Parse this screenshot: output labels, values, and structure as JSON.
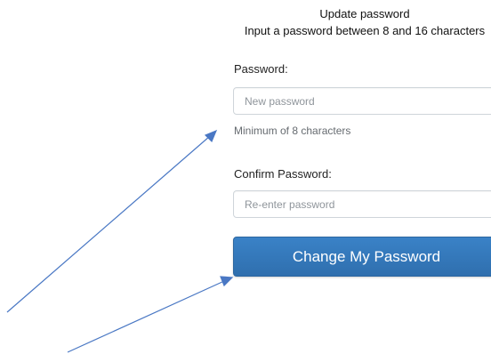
{
  "form": {
    "title": "Update password",
    "subtitle": "Input a password between 8 and 16 characters",
    "password_label": "Password:",
    "password_placeholder": "New password",
    "password_hint": "Minimum of 8 characters",
    "confirm_label": "Confirm Password:",
    "confirm_placeholder": "Re-enter password",
    "submit_label": "Change My Password"
  },
  "colors": {
    "button": "#337ab7",
    "arrow": "#4a78c4"
  }
}
